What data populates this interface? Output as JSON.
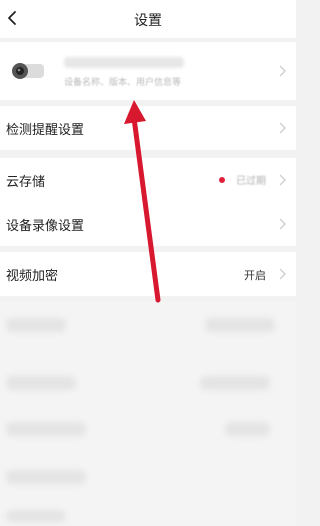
{
  "header": {
    "title": "设置"
  },
  "device": {
    "subtitle": "设备名称、版本、用户信息等"
  },
  "settings": {
    "detection": {
      "label": "检测提醒设置"
    },
    "cloud": {
      "label": "云存储",
      "status": "已过期"
    },
    "recording": {
      "label": "设备录像设置"
    },
    "encryption": {
      "label": "视频加密",
      "value": "开启"
    }
  },
  "colors": {
    "accent_red": "#e0203a",
    "annotation_arrow": "#d8182e"
  },
  "icons": [
    "back-arrow-icon",
    "camera-icon",
    "chevron-right-icon"
  ]
}
